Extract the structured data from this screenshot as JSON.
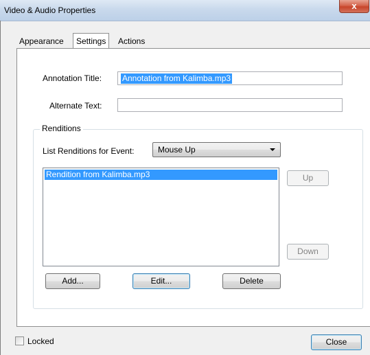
{
  "window": {
    "title": "Video & Audio Properties",
    "close_glyph": "x"
  },
  "tabs": [
    {
      "label": "Appearance"
    },
    {
      "label": "Settings"
    },
    {
      "label": "Actions"
    }
  ],
  "fields": {
    "annotation_title_label": "Annotation Title:",
    "annotation_title_value": "Annotation from Kalimba.mp3",
    "alternate_text_label": "Alternate Text:",
    "alternate_text_value": ""
  },
  "renditions": {
    "group_label": "Renditions",
    "event_label": "List Renditions for Event:",
    "event_value": "Mouse Up",
    "items": [
      "Rendition from Kalimba.mp3"
    ],
    "up_label": "Up",
    "down_label": "Down",
    "add_label": "Add...",
    "edit_label": "Edit...",
    "delete_label": "Delete"
  },
  "footer": {
    "locked_label": "Locked",
    "locked_checked": false,
    "close_label": "Close"
  }
}
